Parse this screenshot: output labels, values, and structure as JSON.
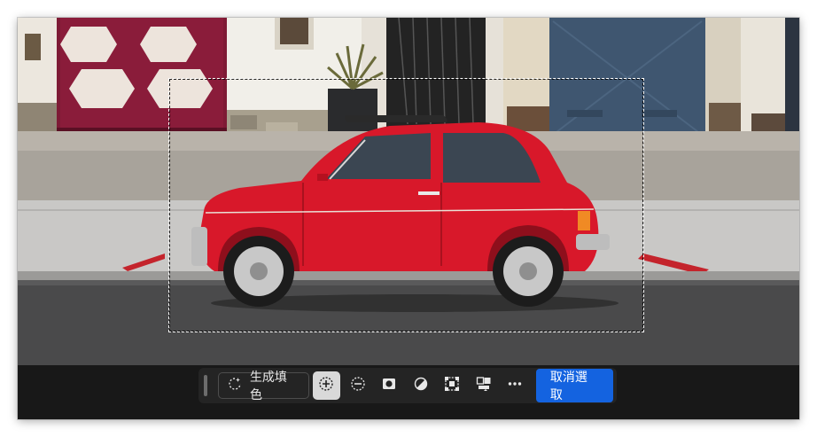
{
  "toolbar": {
    "generative_fill_label": "生成填色",
    "deselect_label": "取消選取"
  },
  "icons": [
    "generative-fill-sparkle-icon",
    "add-to-selection-icon",
    "subtract-from-selection-icon",
    "mask-icon",
    "invert-selection-icon",
    "transform-selection-icon",
    "fill-selection-icon",
    "more-options-icon"
  ],
  "colors": {
    "accent": "#1463e0",
    "car": "#d8182a",
    "toolbar_bg": "#242424"
  }
}
